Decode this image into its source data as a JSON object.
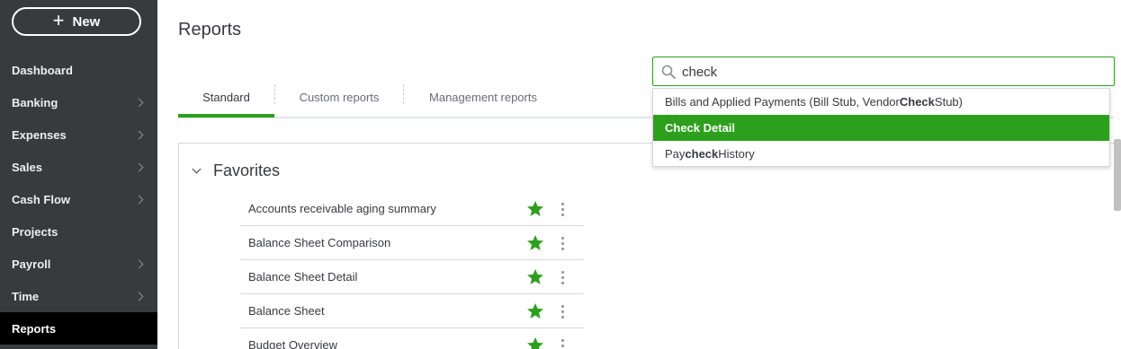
{
  "sidebar": {
    "new_label": "New",
    "items": [
      {
        "label": "Dashboard",
        "has_chevron": false
      },
      {
        "label": "Banking",
        "has_chevron": true
      },
      {
        "label": "Expenses",
        "has_chevron": true
      },
      {
        "label": "Sales",
        "has_chevron": true
      },
      {
        "label": "Cash Flow",
        "has_chevron": true
      },
      {
        "label": "Projects",
        "has_chevron": false
      },
      {
        "label": "Payroll",
        "has_chevron": true
      },
      {
        "label": "Time",
        "has_chevron": true
      },
      {
        "label": "Reports",
        "has_chevron": false,
        "active": true
      }
    ]
  },
  "header": {
    "title": "Reports"
  },
  "tabs": [
    {
      "label": "Standard",
      "active": true
    },
    {
      "label": "Custom reports",
      "active": false
    },
    {
      "label": "Management reports",
      "active": false
    }
  ],
  "search": {
    "value": "check",
    "suggestions": [
      {
        "pre": "Bills and Applied Payments (Bill Stub, Vendor ",
        "match": "Check",
        "post": " Stub)",
        "selected": false
      },
      {
        "pre": "",
        "match": "Check Detail",
        "post": "",
        "selected": true
      },
      {
        "pre": "Pay",
        "match": "check",
        "post": " History",
        "selected": false
      }
    ]
  },
  "favorites": {
    "title": "Favorites",
    "reports": [
      {
        "label": "Accounts receivable aging summary",
        "starred": true
      },
      {
        "label": "Balance Sheet Comparison",
        "starred": true
      },
      {
        "label": "Balance Sheet Detail",
        "starred": true
      },
      {
        "label": "Balance Sheet",
        "starred": true
      },
      {
        "label": "Budget Overview",
        "starred": true
      }
    ]
  },
  "colors": {
    "accent": "#2ca01c",
    "sidebar_bg": "#393a3d",
    "sidebar_active_bg": "#000000"
  },
  "icons": {
    "new": "plus-icon",
    "search": "search-icon",
    "favorite": "star-icon",
    "more": "kebab-menu-icon",
    "nav_expand": "chevron-right-icon",
    "section_toggle": "chevron-down-icon"
  }
}
